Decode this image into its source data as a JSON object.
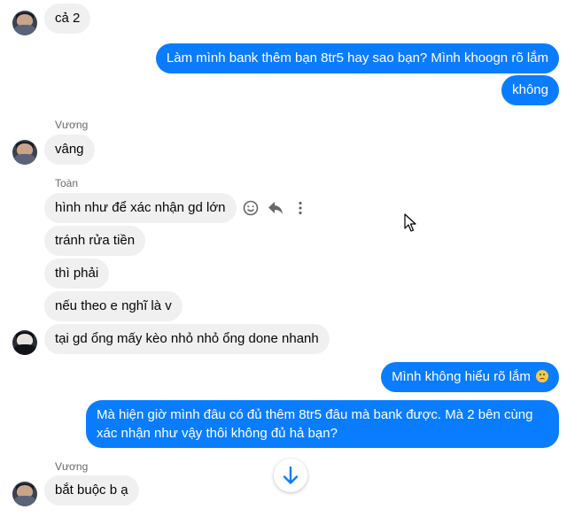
{
  "messages": {
    "m1": "cả 2",
    "m2": "Làm mình bank thêm bạn 8tr5 hay sao bạn? Mình khoogn rõ lắm",
    "m3": "không",
    "sender_vuong_1": "Vương",
    "m4": "vâng",
    "sender_toan": "Toàn",
    "m5": "hình như để xác nhận gd lớn",
    "m6": "tránh rửa tiền",
    "m7": "thì phải",
    "m8": "nếu theo e nghĩ là v",
    "m9": "tại gd ổng mấy kèo nhỏ nhỏ ổng done nhanh",
    "m10": "Mình không hiểu rõ lắm",
    "m11": "Mà hiện giờ mình đâu có đủ thêm 8tr5 đâu mà bank được. Mà 2 bên cùng xác nhận như vậy thôi không đủ hả bạn?",
    "sender_vuong_2": "Vương",
    "m12": "bắt buộc b ạ"
  },
  "icons": {
    "react": "smiley-icon",
    "reply": "reply-icon",
    "more": "more-vertical-icon",
    "scroll": "arrow-down-icon",
    "emoji_in_m10": "disappointed-face-icon"
  },
  "colors": {
    "outgoing_bubble": "#0a7cff",
    "incoming_bubble": "#f0f0f0",
    "sender_name": "#65676b"
  }
}
